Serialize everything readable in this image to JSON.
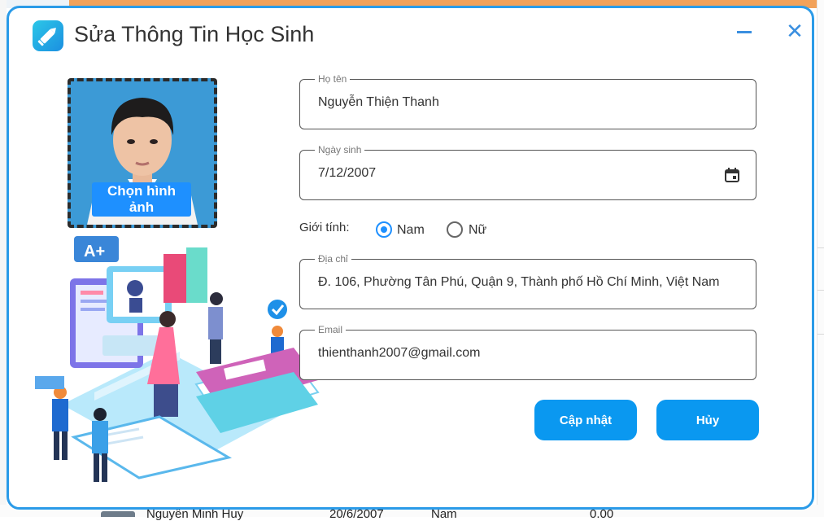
{
  "dialog": {
    "title": "Sửa Thông Tin Học Sinh",
    "app_icon": "edit-pencil-icon",
    "minimize_icon": "minimize-icon",
    "close_icon": "close-icon",
    "accent_color": "#2b9be8"
  },
  "photo": {
    "choose_button_label": "Chọn hình ảnh"
  },
  "form": {
    "fullname": {
      "label": "Họ tên",
      "value": "Nguyễn Thiện Thanh"
    },
    "birthdate": {
      "label": "Ngày sinh",
      "value": "7/12/2007",
      "icon": "calendar-icon"
    },
    "gender": {
      "label": "Giới tính:",
      "options": [
        {
          "label": "Nam",
          "selected": true
        },
        {
          "label": "Nữ",
          "selected": false
        }
      ]
    },
    "address": {
      "label": "Địa chỉ",
      "value": "Đ. 106, Phường Tân Phú, Quận 9, Thành phố Hồ Chí Minh, Việt Nam"
    },
    "email": {
      "label": "Email",
      "value": "thienthanh2007@gmail.com"
    }
  },
  "actions": {
    "update_label": "Cập nhật",
    "cancel_label": "Hủy",
    "button_color": "#0a98f0"
  },
  "background_row": {
    "name": "Nguyễn Minh Huy",
    "date": "20/6/2007",
    "gender": "Nam",
    "score": "0.00"
  }
}
